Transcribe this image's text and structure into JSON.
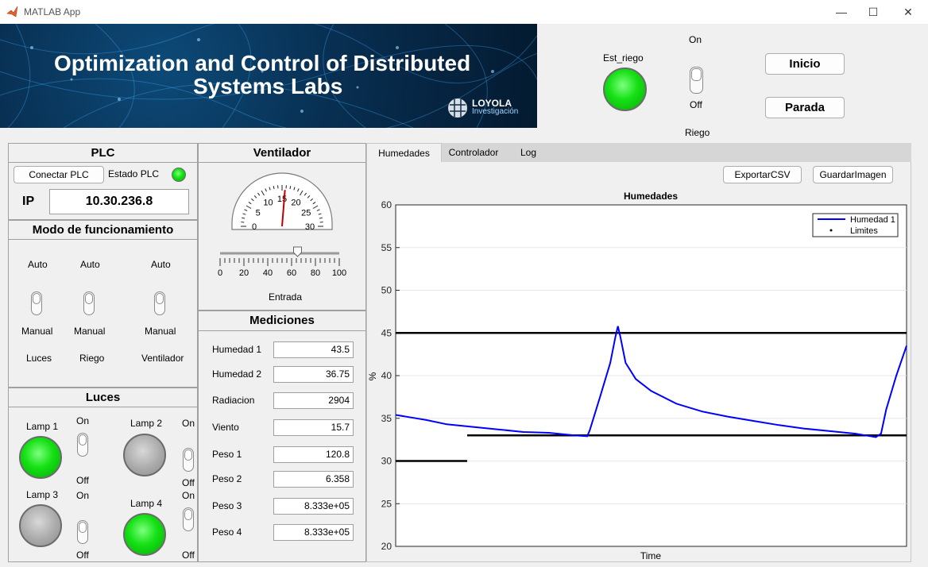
{
  "window": {
    "title": "MATLAB App",
    "controls": [
      "—",
      "☐",
      "✕"
    ]
  },
  "banner": {
    "line1": "Optimization and Control of Distributed",
    "line2": "Systems Labs",
    "logo_line1": "LOYOLA",
    "logo_line2": "Investigación"
  },
  "top": {
    "est_riego_label": "Est_riego",
    "riego_switch": {
      "on": "On",
      "off": "Off",
      "label": "Riego"
    },
    "inicio": "Inicio",
    "parada": "Parada"
  },
  "plc": {
    "title": "PLC",
    "connect_button": "Conectar PLC",
    "estado_label": "Estado PLC",
    "ip_label": "IP",
    "ip_value": "10.30.236.8"
  },
  "modo": {
    "title": "Modo de funcionamiento",
    "switches": [
      {
        "top": "Auto",
        "bottom": "Manual",
        "name": "Luces"
      },
      {
        "top": "Auto",
        "bottom": "Manual",
        "name": "Riego"
      },
      {
        "top": "Auto",
        "bottom": "Manual",
        "name": "Ventilador"
      }
    ]
  },
  "luces": {
    "title": "Luces",
    "lamps": [
      {
        "label": "Lamp 1",
        "on": "On",
        "off": "Off",
        "state": "on"
      },
      {
        "label": "Lamp 2",
        "on": "On",
        "off": "Off",
        "state": "off"
      },
      {
        "label": "Lamp 3",
        "on": "On",
        "off": "Off",
        "state": "off"
      },
      {
        "label": "Lamp 4",
        "on": "On",
        "off": "Off",
        "state": "on"
      }
    ]
  },
  "ventilador": {
    "title": "Ventilador",
    "gauge_ticks": [
      "0",
      "5",
      "10",
      "15",
      "20",
      "25",
      "30"
    ],
    "gauge_value": 15,
    "slider_ticks": [
      "0",
      "20",
      "40",
      "60",
      "80",
      "100"
    ],
    "slider_value": 65,
    "slider_label": "Entrada"
  },
  "mediciones": {
    "title": "Mediciones",
    "rows": [
      {
        "label": "Humedad 1",
        "value": "43.5"
      },
      {
        "label": "Humedad 2",
        "value": "36.75"
      },
      {
        "label": "Radiacion",
        "value": "2904"
      },
      {
        "label": "Viento",
        "value": "15.7"
      },
      {
        "label": "Peso 1",
        "value": "120.8"
      },
      {
        "label": "Peso 2",
        "value": "6.358"
      },
      {
        "label": "Peso 3",
        "value": "8.333e+05"
      },
      {
        "label": "Peso 4",
        "value": "8.333e+05"
      }
    ]
  },
  "tabs": [
    "Humedades",
    "Controlador",
    "Log"
  ],
  "active_tab": "Humedades",
  "actions": {
    "export": "ExportarCSV",
    "save_image": "GuardarImagen"
  },
  "colors": {
    "lamp_on": "#14e014",
    "series": "#0000ff",
    "limits": "#000000"
  },
  "chart_data": {
    "type": "line",
    "title": "Humedades",
    "xlabel": "Time",
    "ylabel": "%",
    "ylim": [
      20,
      60
    ],
    "yticks": [
      "20",
      "25",
      "30",
      "35",
      "40",
      "45",
      "50",
      "55",
      "60"
    ],
    "grid": true,
    "legend": {
      "position": "top-right",
      "entries": [
        "Humedad 1",
        "Limites"
      ]
    },
    "series": [
      {
        "name": "Humedad 1",
        "x": [
          0,
          0.03,
          0.06,
          0.1,
          0.15,
          0.2,
          0.25,
          0.3,
          0.35,
          0.375,
          0.38,
          0.4,
          0.42,
          0.43,
          0.435,
          0.44,
          0.45,
          0.47,
          0.5,
          0.55,
          0.6,
          0.65,
          0.7,
          0.75,
          0.8,
          0.85,
          0.9,
          0.92,
          0.94,
          0.95,
          0.96,
          0.98,
          1.0
        ],
        "values": [
          35.4,
          35.1,
          34.8,
          34.3,
          34.0,
          33.7,
          33.4,
          33.3,
          33.0,
          32.9,
          33.6,
          37.5,
          41.5,
          44.5,
          45.8,
          44.5,
          41.5,
          39.6,
          38.2,
          36.7,
          35.8,
          35.2,
          34.7,
          34.2,
          33.8,
          33.5,
          33.2,
          33.0,
          32.8,
          33.2,
          36.0,
          40.0,
          43.5
        ]
      },
      {
        "name": "Limites",
        "segments": [
          {
            "x": [
              0,
              0.14
            ],
            "values": [
              30,
              30
            ]
          },
          {
            "x": [
              0.14,
              1.0
            ],
            "values": [
              33,
              33
            ]
          },
          {
            "x": [
              0,
              1.0
            ],
            "values": [
              45,
              45
            ]
          }
        ]
      }
    ]
  }
}
